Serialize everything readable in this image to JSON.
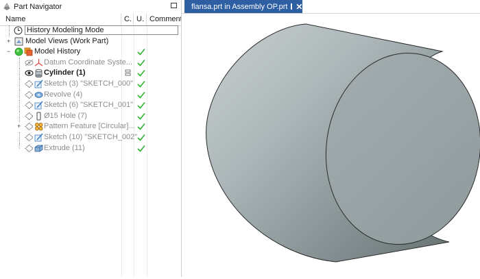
{
  "navigator": {
    "title": "Part Navigator",
    "columns": {
      "name": "Name",
      "c": "C.",
      "u": "U.",
      "comment": "Comment"
    },
    "rows": [
      {
        "label": "History Modeling Mode",
        "style": "normal",
        "check": false
      },
      {
        "label": "Model Views (Work Part)",
        "style": "normal",
        "check": false
      },
      {
        "label": "Model History",
        "style": "normal",
        "check": true
      },
      {
        "label": "Datum Coordinate Syste...",
        "style": "dim",
        "check": true
      },
      {
        "label": "Cylinder (1)",
        "style": "bold",
        "check": true
      },
      {
        "label": "Sketch (3) \"SKETCH_000\"",
        "style": "dim",
        "check": true
      },
      {
        "label": "Revolve (4)",
        "style": "dim",
        "check": true
      },
      {
        "label": "Sketch (6) \"SKETCH_001\"",
        "style": "dim",
        "check": true
      },
      {
        "label": "Ø15 Hole (7)",
        "style": "dim",
        "check": true
      },
      {
        "label": "Pattern Feature [Circular]...",
        "style": "dim",
        "check": true
      },
      {
        "label": "Sketch (10) \"SKETCH_002\"",
        "style": "dim",
        "check": true
      },
      {
        "label": "Extrude (11)",
        "style": "dim",
        "check": true
      }
    ]
  },
  "graphics_tab": {
    "title": "flansa.prt in Assembly OP.prt",
    "icon": "part-file-icon",
    "float_icon": "float-window-icon",
    "close_icon": "close-icon"
  },
  "colors": {
    "tab_active": "#2e5fa3",
    "check_green": "#2fb52f",
    "cylinder_face": "#9aa6a8",
    "cylinder_side_dark": "#6c787a",
    "cylinder_side_light": "#c3cbcc"
  }
}
